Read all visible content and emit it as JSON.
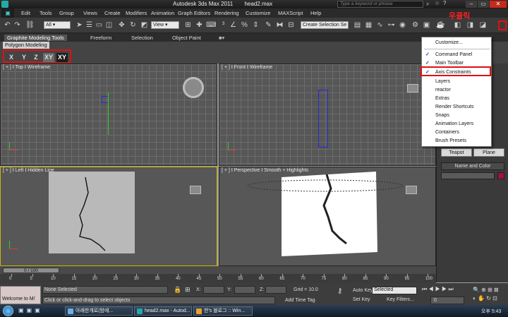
{
  "window": {
    "app_title": "Autodesk 3ds Max  2011",
    "file_title": "head2.max",
    "search_placeholder": "Type a keyword or phrase"
  },
  "menu": [
    "Edit",
    "Tools",
    "Group",
    "Views",
    "Create",
    "Modifiers",
    "Animation",
    "Graph Editors",
    "Rendering",
    "Customize",
    "MAXScript",
    "Help"
  ],
  "toolbar": {
    "selection_filter": "All",
    "ref_coord": "View",
    "named_selection": "Create Selection Se"
  },
  "ribbon": {
    "tabs": [
      "Graphite Modeling Tools",
      "Freeform",
      "Selection",
      "Object Paint"
    ],
    "panel_label": "Polygon Modeling"
  },
  "axis_constraints": [
    "X",
    "Y",
    "Z",
    "XY",
    "XY"
  ],
  "viewports": {
    "top": {
      "plus": "[ + ]",
      "name": "Top",
      "mode": "Wireframe"
    },
    "front": {
      "plus": "[ + ]",
      "name": "Front",
      "mode": "Wireframe"
    },
    "left": {
      "plus": "[ + ]",
      "name": "Left",
      "mode": "Hidden Line"
    },
    "perspective": {
      "plus": "[ + ]",
      "name": "Perspective",
      "mode": "Smooth + Highlights"
    }
  },
  "context_menu": {
    "items": [
      {
        "label": "Customize...",
        "checked": false
      },
      {
        "label": "Command Panel",
        "checked": true
      },
      {
        "label": "Main Toolbar",
        "checked": true
      },
      {
        "label": "Axis Constraints",
        "checked": true
      },
      {
        "label": "Layers",
        "checked": false
      },
      {
        "label": "reactor",
        "checked": false
      },
      {
        "label": "Extras",
        "checked": false
      },
      {
        "label": "Render Shortcuts",
        "checked": false
      },
      {
        "label": "Snaps",
        "checked": false
      },
      {
        "label": "Animation Layers",
        "checked": false
      },
      {
        "label": "Containers",
        "checked": false
      },
      {
        "label": "Brush Presets",
        "checked": false
      }
    ]
  },
  "annotation": {
    "right_click_label": "우클릭"
  },
  "command_panel": {
    "teapot": "Teapot",
    "plane": "Plane",
    "name_and_color": "Name and Color"
  },
  "timeline": {
    "slider": "0 / 100",
    "ticks": [
      "0",
      "5",
      "10",
      "15",
      "20",
      "25",
      "30",
      "35",
      "40",
      "45",
      "50",
      "55",
      "60",
      "65",
      "70",
      "75",
      "80",
      "85",
      "90",
      "95",
      "100"
    ]
  },
  "status": {
    "welcome": "Welcome to M/",
    "selection": "None Selected",
    "prompt": "Click or click-and-drag to select objects",
    "x_label": "X:",
    "y_label": "Y:",
    "z_label": "Z:",
    "grid": "Grid = 10.0",
    "add_time_tag": "Add Time Tag",
    "auto_key": "Auto Key",
    "set_key": "Set Key",
    "key_mode": "Selected",
    "key_filters": "Key Filters...",
    "frame": "0"
  },
  "taskbar": {
    "tasks": [
      "아래한개로(밤에...",
      "head2.max - Autod...",
      "한's 블로그 :: Win..."
    ],
    "clock": "오후 5:43"
  },
  "colors": {
    "highlight_red": "#e01010",
    "viewport_bg": "#575757",
    "active_viewport_border": "#c8b400"
  }
}
